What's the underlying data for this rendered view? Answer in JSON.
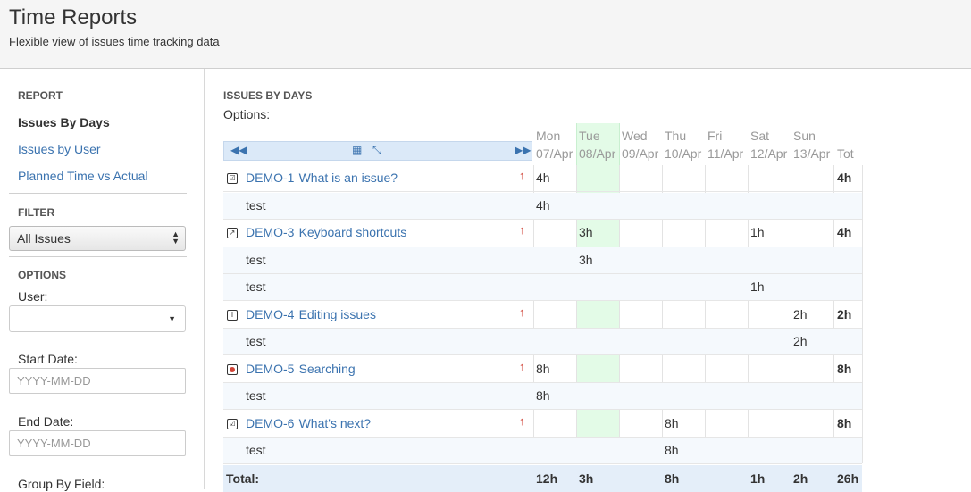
{
  "header": {
    "title": "Time Reports",
    "subtitle": "Flexible view of issues time tracking data"
  },
  "sidebar": {
    "report_heading": "REPORT",
    "report_items": [
      "Issues By Days",
      "Issues by User",
      "Planned Time vs Actual"
    ],
    "filter_heading": "FILTER",
    "filter_value": "All Issues",
    "options_heading": "OPTIONS",
    "user_label": "User:",
    "user_value": "",
    "start_date_label": "Start Date:",
    "start_date_placeholder": "YYYY-MM-DD",
    "end_date_label": "End Date:",
    "end_date_placeholder": "YYYY-MM-DD",
    "group_by_label": "Group By Field:"
  },
  "main": {
    "heading": "ISSUES BY DAYS",
    "options_label": "Options:",
    "days": [
      {
        "day": "Mon",
        "date": "07/Apr"
      },
      {
        "day": "Tue",
        "date": "08/Apr"
      },
      {
        "day": "Wed",
        "date": "09/Apr"
      },
      {
        "day": "Thu",
        "date": "10/Apr"
      },
      {
        "day": "Fri",
        "date": "11/Apr"
      },
      {
        "day": "Sat",
        "date": "12/Apr"
      },
      {
        "day": "Sun",
        "date": "13/Apr"
      }
    ],
    "total_col_label": "Tot",
    "rows": [
      {
        "kind": "issue",
        "key": "DEMO-1",
        "summary": "What is an issue?",
        "icon": "task-icon",
        "cells": [
          "4h",
          "",
          "",
          "",
          "",
          "",
          ""
        ],
        "total": "4h"
      },
      {
        "kind": "sub",
        "label": "test",
        "cells": [
          "4h",
          "",
          "",
          "",
          "",
          "",
          ""
        ],
        "total": ""
      },
      {
        "kind": "issue",
        "key": "DEMO-3",
        "summary": "Keyboard shortcuts",
        "icon": "improvement-icon",
        "cells": [
          "",
          "3h",
          "",
          "",
          "",
          "1h",
          ""
        ],
        "total": "4h"
      },
      {
        "kind": "sub",
        "label": "test",
        "cells": [
          "",
          "3h",
          "",
          "",
          "",
          "",
          ""
        ],
        "total": ""
      },
      {
        "kind": "sub",
        "label": "test",
        "cells": [
          "",
          "",
          "",
          "",
          "",
          "1h",
          ""
        ],
        "total": ""
      },
      {
        "kind": "issue",
        "key": "DEMO-4",
        "summary": "Editing issues",
        "icon": "new-feature-icon",
        "cells": [
          "",
          "",
          "",
          "",
          "",
          "",
          "2h"
        ],
        "total": "2h"
      },
      {
        "kind": "sub",
        "label": "test",
        "cells": [
          "",
          "",
          "",
          "",
          "",
          "",
          "2h"
        ],
        "total": ""
      },
      {
        "kind": "issue",
        "key": "DEMO-5",
        "summary": "Searching",
        "icon": "bug-icon",
        "cells": [
          "8h",
          "",
          "",
          "",
          "",
          "",
          ""
        ],
        "total": "8h"
      },
      {
        "kind": "sub",
        "label": "test",
        "cells": [
          "8h",
          "",
          "",
          "",
          "",
          "",
          ""
        ],
        "total": ""
      },
      {
        "kind": "issue",
        "key": "DEMO-6",
        "summary": "What's next?",
        "icon": "task-icon",
        "cells": [
          "",
          "",
          "",
          "8h",
          "",
          "",
          ""
        ],
        "total": "8h"
      },
      {
        "kind": "sub",
        "label": "test",
        "cells": [
          "",
          "",
          "",
          "8h",
          "",
          "",
          ""
        ],
        "total": ""
      }
    ],
    "total_row": {
      "label": "Total:",
      "cells": [
        "12h",
        "3h",
        "",
        "8h",
        "",
        "1h",
        "2h"
      ],
      "total": "26h"
    }
  },
  "colors": {
    "link": "#3b73af",
    "priority_major": "#d04437",
    "today_column": "#e3fbe7",
    "subrow": "#f5f9fd",
    "total_row": "#e4eef9"
  }
}
